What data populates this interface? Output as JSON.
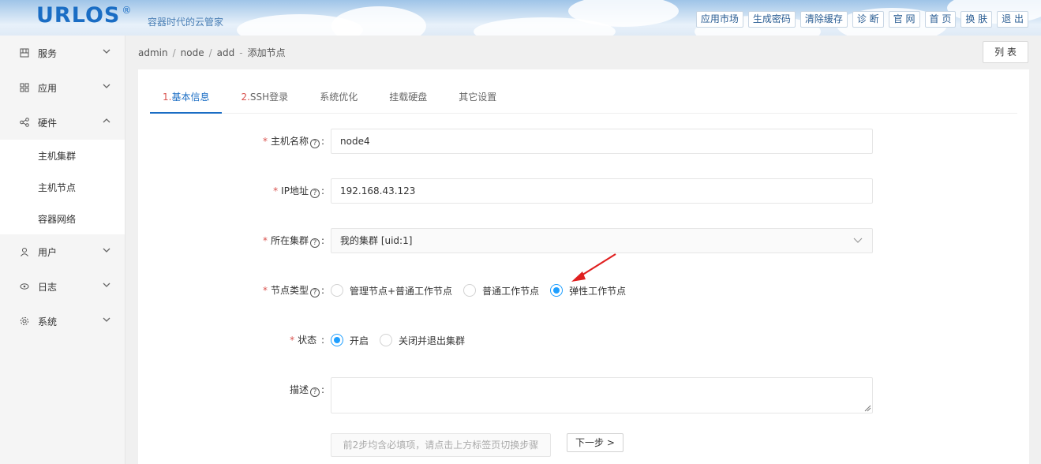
{
  "header": {
    "logo": "URLOS",
    "logo_mark": "®",
    "slogan": "容器时代的云管家",
    "nav": [
      "应用市场",
      "生成密码",
      "清除缓存",
      "诊 断",
      "官 网",
      "首 页",
      "换 肤",
      "退 出"
    ]
  },
  "sidebar": {
    "items": [
      {
        "label": "服务",
        "icon": "grid-icon"
      },
      {
        "label": "应用",
        "icon": "apps-icon"
      },
      {
        "label": "硬件",
        "icon": "share-icon"
      }
    ],
    "sub_items": [
      "主机集群",
      "主机节点",
      "容器网络"
    ],
    "items_after": [
      {
        "label": "用户",
        "icon": "user-icon"
      },
      {
        "label": "日志",
        "icon": "eye-icon"
      },
      {
        "label": "系统",
        "icon": "gear-icon"
      }
    ]
  },
  "breadcrumb": {
    "parts": [
      "admin",
      "node",
      "add"
    ],
    "title": "添加节点"
  },
  "list_button": "列 表",
  "tabs": [
    {
      "num": "1.",
      "label": "基本信息"
    },
    {
      "num": "2.",
      "label": "SSH登录"
    },
    {
      "num": "",
      "label": "系统优化"
    },
    {
      "num": "",
      "label": "挂载硬盘"
    },
    {
      "num": "",
      "label": "其它设置"
    }
  ],
  "form": {
    "hostname": {
      "label": "主机名称",
      "value": "node4"
    },
    "ip": {
      "label": "IP地址",
      "value": "192.168.43.123"
    },
    "cluster": {
      "label": "所在集群",
      "value": "我的集群 [uid:1]"
    },
    "node_type": {
      "label": "节点类型",
      "options": [
        "管理节点+普通工作节点",
        "普通工作节点",
        "弹性工作节点"
      ],
      "selected": 2
    },
    "status": {
      "label": "状态",
      "options": [
        "开启",
        "关闭并退出集群"
      ],
      "selected": 0
    },
    "description": {
      "label": "描述",
      "value": ""
    },
    "hint": "前2步均含必填项，请点击上方标签页切换步骤",
    "next": "下一步"
  },
  "colors": {
    "accent": "#1a6dc4",
    "required": "#d9534f",
    "radio": "#1e9fff",
    "arrow": "#e02020"
  }
}
